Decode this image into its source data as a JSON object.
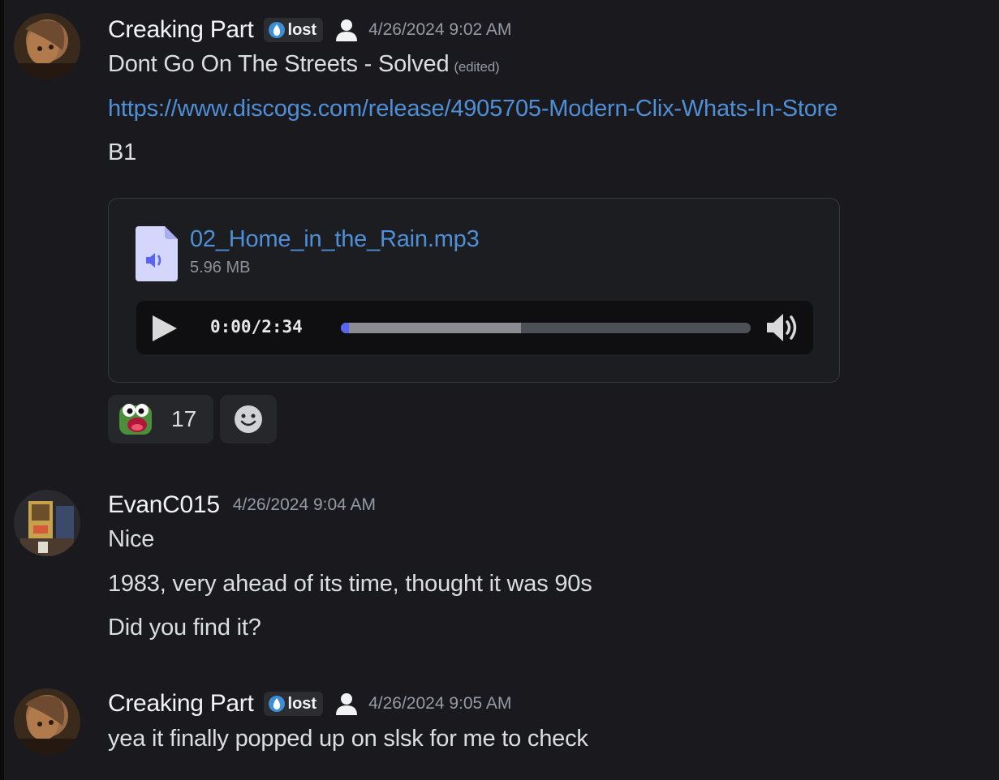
{
  "colors": {
    "background": "#1a1a1e",
    "link": "#4f8fd8",
    "accent": "#5865f2",
    "muted": "#949ba4"
  },
  "messages": [
    {
      "author": "Creaking Part",
      "tag": "lost",
      "tag_icon": "water-drop-icon",
      "show_person_icon": true,
      "timestamp": "4/26/2024 9:02 AM",
      "lines": [
        {
          "text": "Dont Go On The Streets  - Solved",
          "edited_label": "(edited)"
        },
        {
          "text": "https://www.discogs.com/release/4905705-Modern-Clix-Whats-In-Store",
          "is_link": true
        },
        {
          "text": "B1"
        }
      ],
      "attachment": {
        "file_name": "02_Home_in_the_Rain.mp3",
        "file_size": "5.96 MB",
        "player": {
          "current_time": "0:00",
          "separator": "/",
          "duration": "2:34",
          "progress": 0.0,
          "buffered": 0.44
        }
      },
      "reactions": [
        {
          "emoji": "pepe-frog-emoji",
          "count": "17"
        }
      ],
      "add_reaction_icon": "smile-icon"
    },
    {
      "author": "EvanC015",
      "timestamp": "4/26/2024 9:04 AM",
      "lines": [
        {
          "text": "Nice"
        },
        {
          "text": "1983, very ahead of its time, thought it was 90s"
        },
        {
          "text": "Did you find it?"
        }
      ]
    },
    {
      "author": "Creaking Part",
      "tag": "lost",
      "tag_icon": "water-drop-icon",
      "show_person_icon": true,
      "timestamp": "4/26/2024 9:05 AM",
      "lines": [
        {
          "text": "yea it finally popped up on slsk for me to check"
        }
      ]
    }
  ]
}
